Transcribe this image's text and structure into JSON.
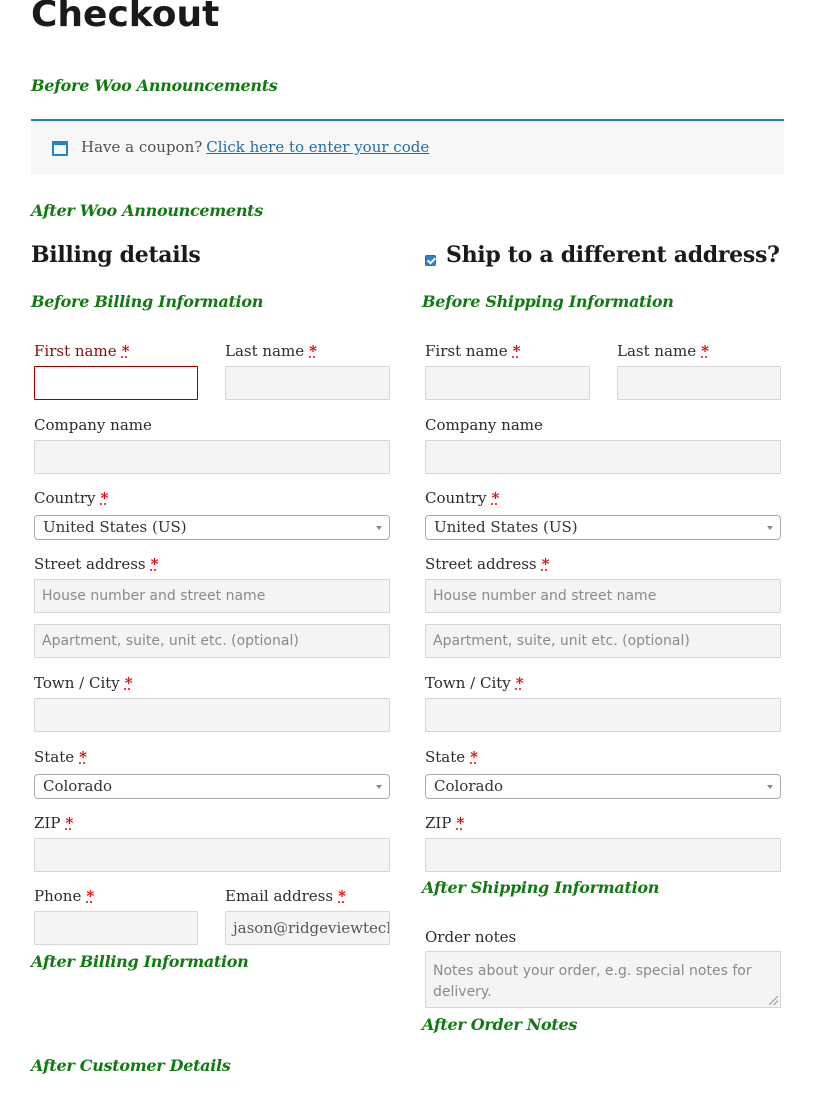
{
  "page": {
    "title": "Checkout"
  },
  "hooks": {
    "before_woo_announcements": "Before Woo Announcements",
    "after_woo_announcements": "After Woo Announcements",
    "before_billing": "Before Billing Information",
    "before_shipping": "Before Shipping Information",
    "after_shipping": "After Shipping Information",
    "after_billing": "After Billing Information",
    "after_order_notes": "After Order Notes",
    "after_customer_details": "After Customer Details"
  },
  "notice": {
    "icon": "window-icon",
    "text": "Have a coupon?",
    "link": "Click here to enter your code",
    "accent": "#1e85be"
  },
  "billing": {
    "heading": "Billing details",
    "first_name": {
      "label": "First name",
      "value": ""
    },
    "last_name": {
      "label": "Last name",
      "value": ""
    },
    "company": {
      "label": "Company name",
      "value": ""
    },
    "country": {
      "label": "Country",
      "value": "United States (US)"
    },
    "street": {
      "label": "Street address",
      "placeholder1": "House number and street name",
      "placeholder2": "Apartment, suite, unit etc. (optional)"
    },
    "city": {
      "label": "Town / City",
      "value": ""
    },
    "state": {
      "label": "State",
      "value": "Colorado"
    },
    "zip": {
      "label": "ZIP",
      "value": ""
    },
    "phone": {
      "label": "Phone",
      "value": ""
    },
    "email": {
      "label": "Email address",
      "value": "jason@ridgeviewtech"
    }
  },
  "shipping": {
    "heading": "Ship to a different address?",
    "checked": true,
    "first_name": {
      "label": "First name",
      "value": ""
    },
    "last_name": {
      "label": "Last name",
      "value": ""
    },
    "company": {
      "label": "Company name",
      "value": ""
    },
    "country": {
      "label": "Country",
      "value": "United States (US)"
    },
    "street": {
      "label": "Street address",
      "placeholder1": "House number and street name",
      "placeholder2": "Apartment, suite, unit etc. (optional)"
    },
    "city": {
      "label": "Town / City",
      "value": ""
    },
    "state": {
      "label": "State",
      "value": "Colorado"
    },
    "zip": {
      "label": "ZIP",
      "value": ""
    }
  },
  "order_notes": {
    "label": "Order notes",
    "placeholder": "Notes about your order, e.g. special notes for delivery."
  },
  "required_mark": "*",
  "colors": {
    "hook": "#117a11",
    "required": "#e10000",
    "error": "#8b0a0a",
    "link": "#1e6fa8"
  }
}
